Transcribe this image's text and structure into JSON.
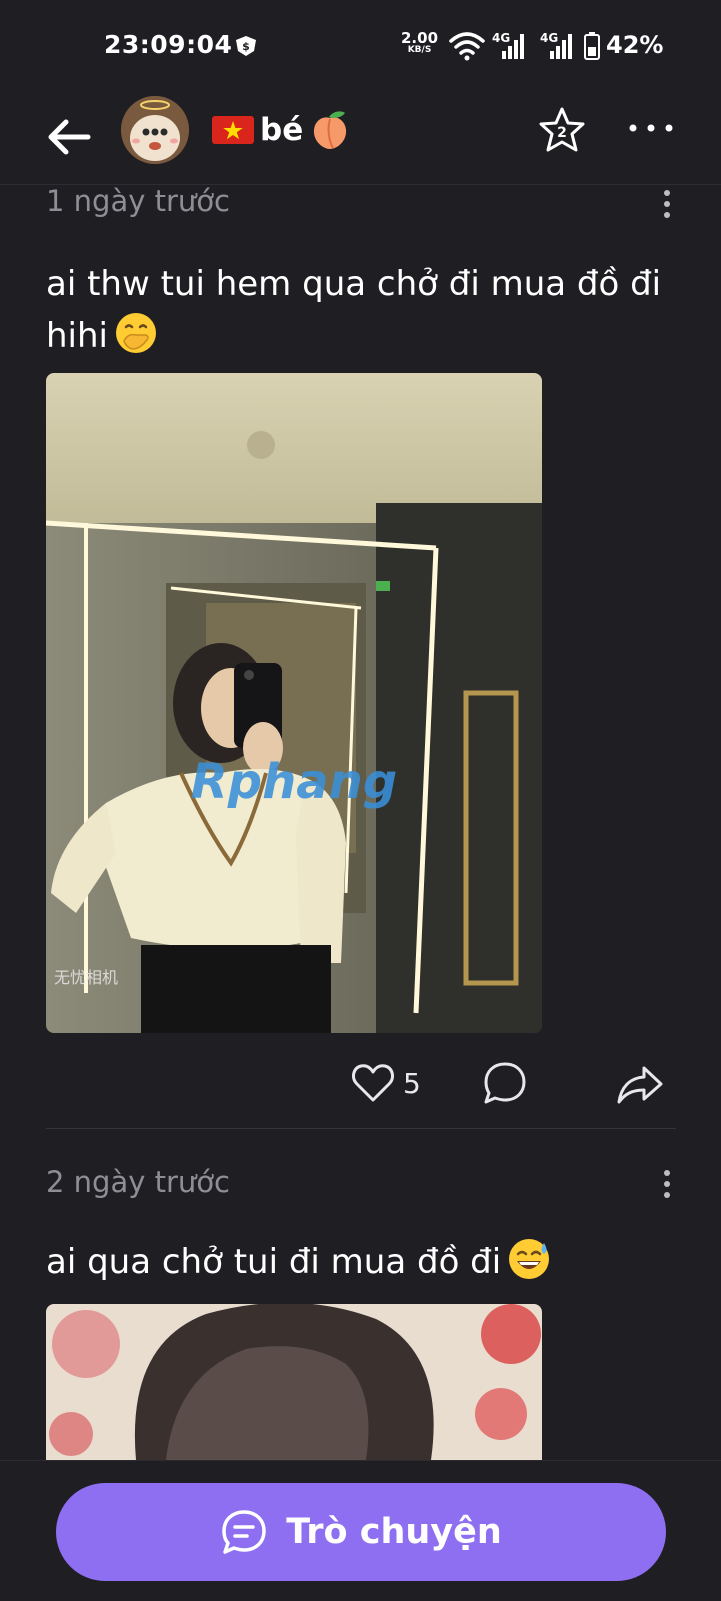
{
  "status_bar": {
    "time": "23:09:04",
    "net_speed": "2.00",
    "net_speed_unit": "KB/S",
    "signal1_label": "4G",
    "signal2_label": "4G",
    "battery": "42%"
  },
  "header": {
    "name": "bé",
    "icons": [
      "back-arrow-icon",
      "avatar",
      "vietnam-flag-icon",
      "peach-emoji-icon",
      "star-badge-icon",
      "more-icon"
    ],
    "star_badge_count": "2"
  },
  "posts": [
    {
      "time": "1 ngày trước",
      "text": "ai thw tui hem qua chở đi mua đồ đi hihi",
      "emoji": "hand-over-mouth-emoji-icon",
      "photo_overlay_text": "Rphang",
      "photo_corner_text": "无忧相机",
      "likes": "5"
    },
    {
      "time": "2 ngày trước",
      "text": "ai qua chở tui đi mua đồ đi",
      "emoji": "grinning-sweat-emoji-icon"
    }
  ],
  "bottom": {
    "chat_label": "Trò chuyện"
  },
  "colors": {
    "background": "#1f1e23",
    "accent": "#8e6ff2",
    "muted_text": "#8e8e94"
  }
}
